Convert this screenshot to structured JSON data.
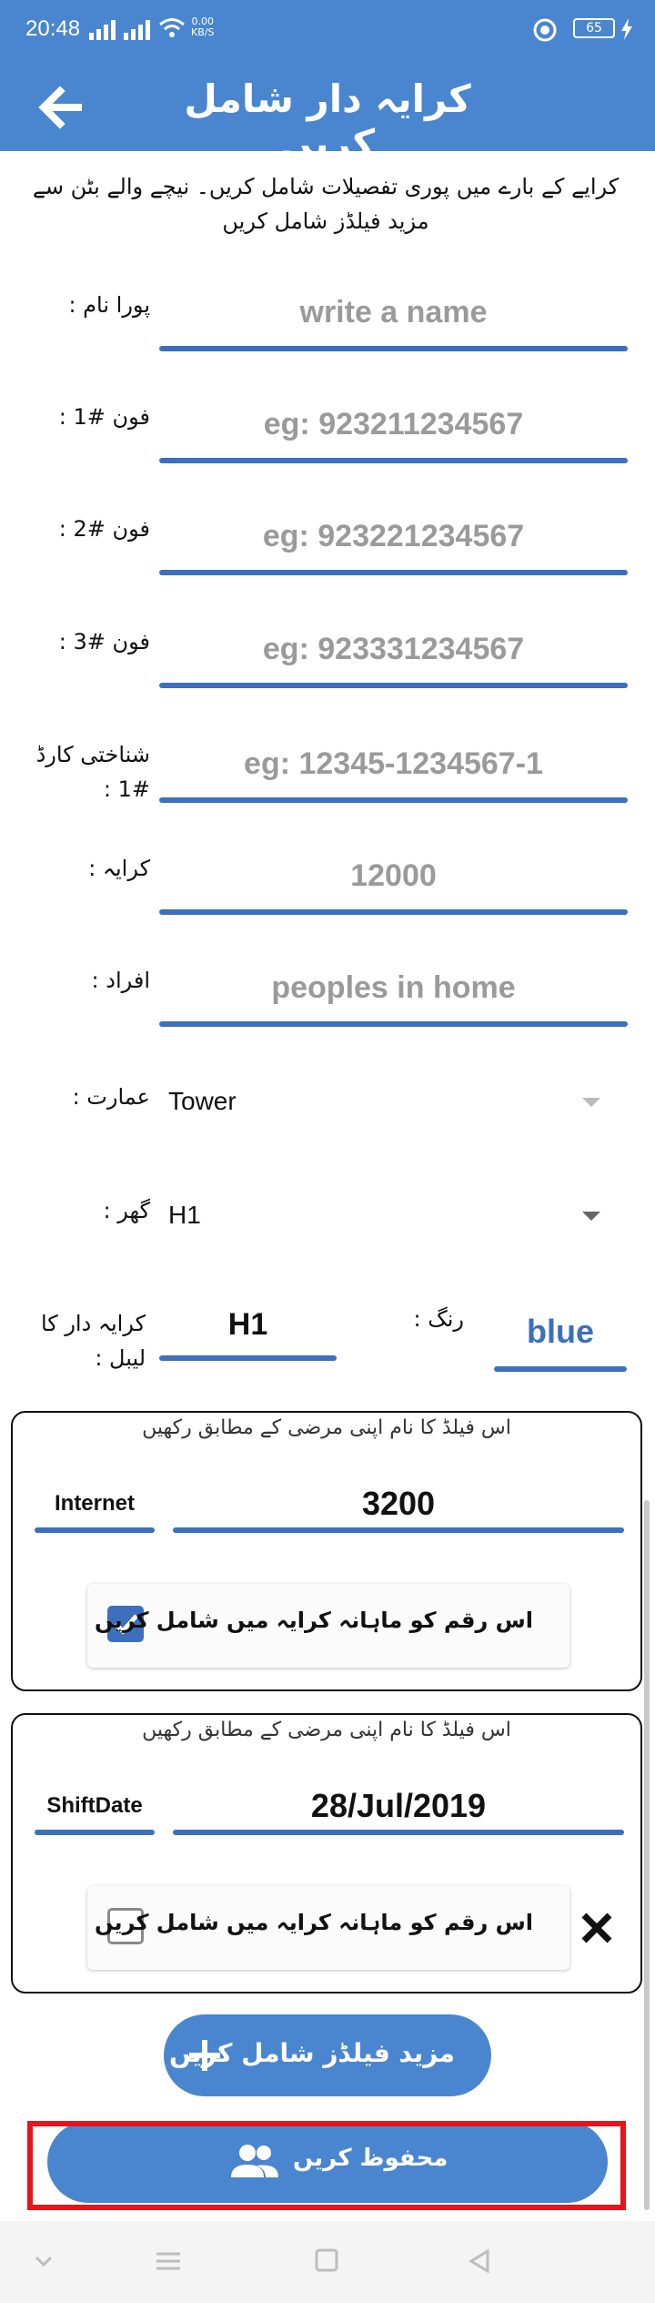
{
  "status_bar": {
    "time": "20:48",
    "net_speed": "0.00",
    "net_unit": "KB/S",
    "battery": "65"
  },
  "app_bar": {
    "title": "کرایہ دار شامل کریں"
  },
  "intro_text": "کرایے کے بارے میں پوری تفصیلات شامل کریں۔ نیچے والے بٹن سے مزید فیلڈز شامل کریں",
  "form": {
    "full_name": {
      "label": "پورا نام :",
      "placeholder": "write a name"
    },
    "phone1": {
      "label": "فون #1 :",
      "placeholder": "eg: 923211234567"
    },
    "phone2": {
      "label": "فون #2 :",
      "placeholder": "eg: 923221234567"
    },
    "phone3": {
      "label": "فون #3 :",
      "placeholder": "eg: 923331234567"
    },
    "cnic": {
      "label": "شناختی کارڈ #1 :",
      "placeholder": "eg: 12345-1234567-1"
    },
    "rent": {
      "label": "کرایہ :",
      "placeholder": "12000"
    },
    "people": {
      "label": "افراد :",
      "placeholder": "peoples in home"
    },
    "building": {
      "label": "عمارت :",
      "value": "Tower"
    },
    "house": {
      "label": "گھر :",
      "value": "H1"
    },
    "tenant_label": {
      "label": "کرایہ دار کا لیبل :",
      "value": "H1"
    },
    "color": {
      "label": "رنگ :",
      "value": "blue"
    }
  },
  "custom_fields": [
    {
      "hint": "اس فیلڈ کا نام اپنی مرضی کے مطابق رکھیں",
      "name": "Internet",
      "value": "3200",
      "include_label": "اس رقم کو ماہانہ کرایہ میں شامل کریں",
      "included": true
    },
    {
      "hint": "اس فیلڈ کا نام اپنی مرضی کے مطابق رکھیں",
      "name": "ShiftDate",
      "value": "28/Jul/2019",
      "include_label": "اس رقم کو ماہانہ کرایہ میں شامل کریں",
      "included": false
    }
  ],
  "buttons": {
    "add_more": "مزید فیلڈز شامل کریں",
    "save": "محفوظ کریں"
  },
  "colors": {
    "primary": "#4a86cf",
    "underline": "#3c6fbd",
    "highlight": "#e8141b"
  }
}
